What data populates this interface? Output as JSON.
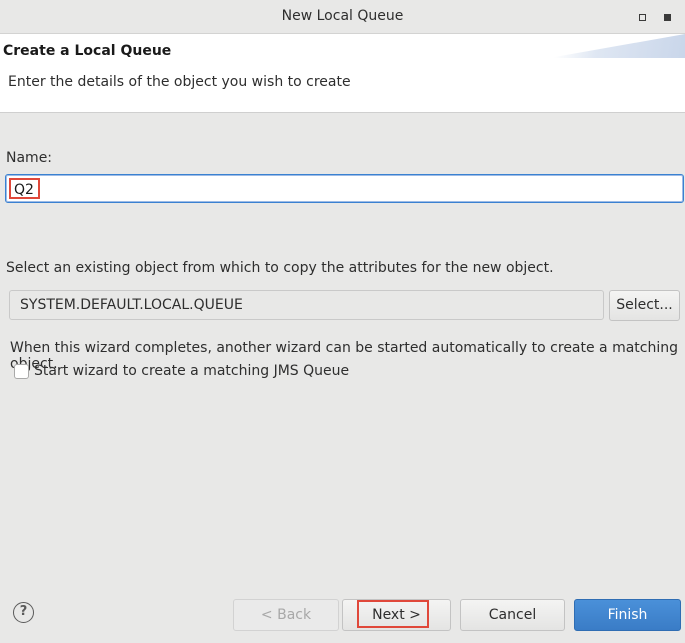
{
  "window": {
    "title": "New Local Queue"
  },
  "header": {
    "title": "Create a Local Queue",
    "description": "Enter the details of the object you wish to create"
  },
  "form": {
    "name_label": "Name:",
    "name_value": "Q2",
    "copy_label": "Select an existing object from which to copy the attributes for the new object.",
    "copy_value": "SYSTEM.DEFAULT.LOCAL.QUEUE",
    "select_button": "Select...",
    "wizard_note": "When this wizard completes, another wizard can be started automatically to create a matching object.",
    "jms_checkbox_label": "Start wizard to create a matching JMS Queue",
    "jms_checkbox_checked": false
  },
  "footer": {
    "help_glyph": "?",
    "back_label": "< Back",
    "next_label": "Next >",
    "cancel_label": "Cancel",
    "finish_label": "Finish"
  },
  "colors": {
    "accent": "#3a7cc6",
    "highlight": "#e0483a",
    "background": "#e8e8e7"
  }
}
